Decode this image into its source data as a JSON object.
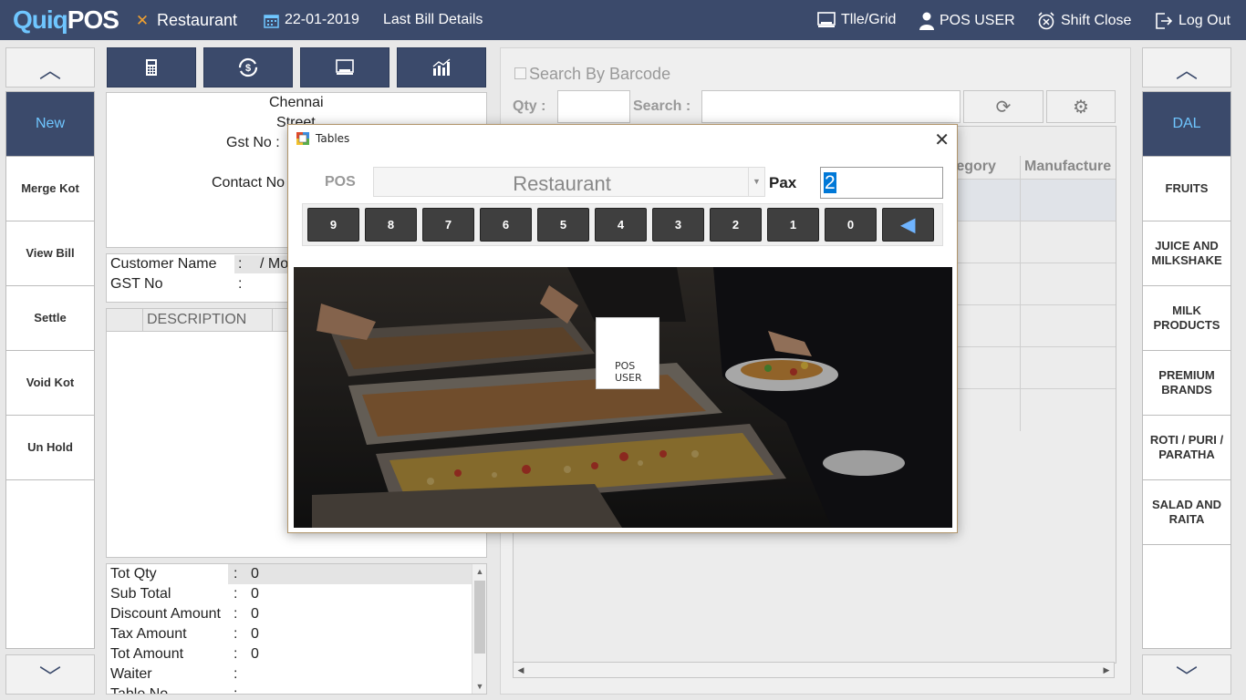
{
  "topbar": {
    "logo_part1": "Quiq",
    "logo_part2": "POS",
    "outlet": "Restaurant",
    "date": "22-01-2019",
    "last_bill": "Last Bill Details",
    "tile_grid": "Tlle/Grid",
    "user": "POS USER",
    "shift_close": "Shift Close",
    "logout": "Log Out"
  },
  "left_menu": {
    "items": [
      "New",
      "Merge Kot",
      "View Bill",
      "Settle",
      "Void Kot",
      "Un Hold"
    ]
  },
  "bill": {
    "city": "Chennai",
    "street": "Street",
    "gst_label": "Gst No :",
    "contact_label": "Contact No",
    "customer_name_label": "Customer Name",
    "customer_name_sep": ":",
    "customer_name_val": "/ Mo",
    "gst_no_label": "GST No",
    "gst_no_sep": ":",
    "desc_header": "DESCRIPTION"
  },
  "totals": {
    "rows": [
      {
        "label": "Tot Qty",
        "sep": ":",
        "value": "0"
      },
      {
        "label": "Sub Total",
        "sep": ":",
        "value": "0"
      },
      {
        "label": "Discount Amount",
        "sep": ":",
        "value": "0"
      },
      {
        "label": "Tax Amount",
        "sep": ":",
        "value": "0"
      },
      {
        "label": "Tot Amount",
        "sep": ":",
        "value": "0"
      },
      {
        "label": "Waiter",
        "sep": ":",
        "value": ""
      },
      {
        "label": "Table No",
        "sep": ":",
        "value": ""
      }
    ]
  },
  "right_panel": {
    "barcode_label": "Search By Barcode",
    "qty_label": "Qty :",
    "search_label": "Search :",
    "col_category": "tegory",
    "col_manufacture": "Manufacture"
  },
  "right_menu": {
    "items": [
      "DAL",
      "FRUITS",
      "JUICE AND MILKSHAKE",
      "MILK PRODUCTS",
      "PREMIUM BRANDS",
      "ROTI / PURI / PARATHA",
      "SALAD AND RAITA"
    ]
  },
  "dialog": {
    "title": "Tables",
    "pos_label": "POS",
    "pos_value": "Restaurant",
    "pax_label": "Pax",
    "pax_value": "2",
    "keys": [
      "9",
      "8",
      "7",
      "6",
      "5",
      "4",
      "3",
      "2",
      "1",
      "0"
    ],
    "table_tile_line1": "POS",
    "table_tile_line2": "USER"
  },
  "colors": {
    "brand_dark": "#3b4a6b",
    "accent": "#6fc6ff",
    "selection": "#0078d7"
  }
}
